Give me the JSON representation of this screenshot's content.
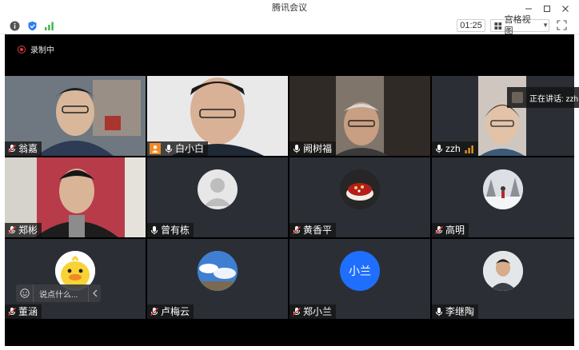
{
  "window": {
    "title": "腾讯会议"
  },
  "toolbar": {
    "timer": "01:25",
    "view_label": "宫格视图"
  },
  "status": {
    "recording_label": "录制中",
    "speaking_label": "正在讲话: zzh"
  },
  "chat": {
    "placeholder": "说点什么..."
  },
  "participants": [
    {
      "name": "翁嘉",
      "mic": "muted",
      "type": "video"
    },
    {
      "name": "白小白",
      "mic": "on",
      "type": "video",
      "host": true
    },
    {
      "name": "阙树福",
      "mic": "on",
      "type": "video"
    },
    {
      "name": "zzh",
      "mic": "on",
      "type": "video",
      "speaking": true
    },
    {
      "name": "郑彬",
      "mic": "muted",
      "type": "video"
    },
    {
      "name": "曾有栋",
      "mic": "on",
      "type": "avatar",
      "avatar": "default-person"
    },
    {
      "name": "黄香平",
      "mic": "muted",
      "type": "avatar",
      "avatar": "cake-photo"
    },
    {
      "name": "高明",
      "mic": "muted",
      "type": "avatar",
      "avatar": "snow-street-photo"
    },
    {
      "name": "董涵",
      "mic": "muted",
      "type": "avatar",
      "avatar": "duck-cartoon"
    },
    {
      "name": "卢梅云",
      "mic": "muted",
      "type": "avatar",
      "avatar": "sky-photo"
    },
    {
      "name": "郑小兰",
      "mic": "muted",
      "type": "avatar",
      "avatar": "text-avatar",
      "avatar_text": "小兰",
      "avatar_color": "#1f6fff"
    },
    {
      "name": "李继陶",
      "mic": "on",
      "type": "avatar",
      "avatar": "portrait-photo"
    }
  ],
  "colors": {
    "tile_bg": "#2b2f35",
    "stage_bg": "#000000",
    "recording": "#e23b3b",
    "host_badge": "#f08a24",
    "signal_good": "#3cb54a",
    "signal_speaking": "#f0a020"
  }
}
